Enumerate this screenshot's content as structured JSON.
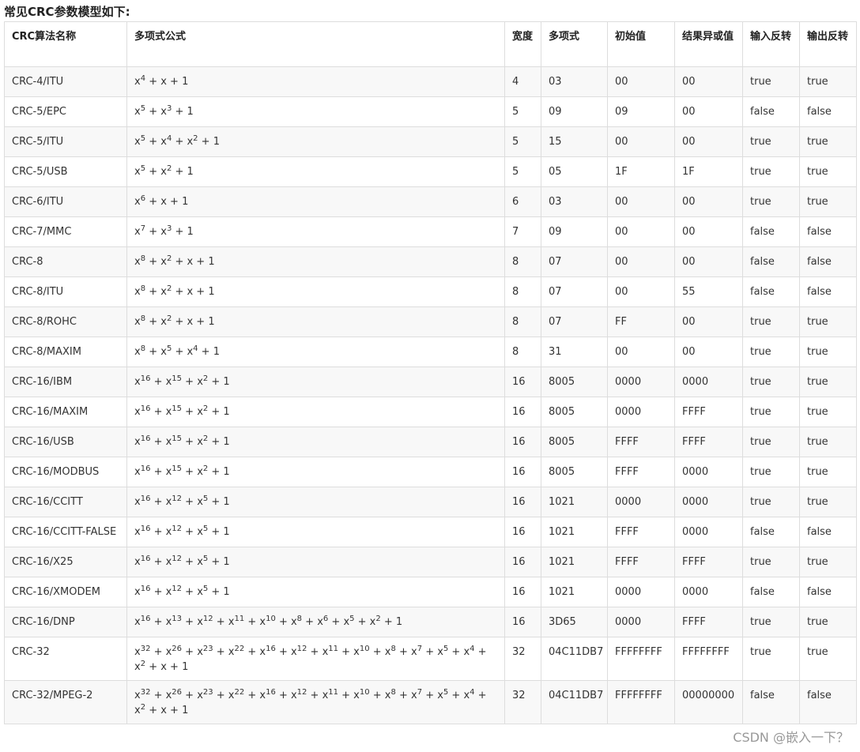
{
  "heading": "常见CRC参数模型如下:",
  "columns": [
    "CRC算法名称",
    "多项式公式",
    "宽度",
    "多项式",
    "初始值",
    "结果异或值",
    "输入反转",
    "输出反转"
  ],
  "rows": [
    {
      "name": "CRC-4/ITU",
      "formula": "x^4 + x + 1",
      "width": "4",
      "poly": "03",
      "init": "00",
      "xorout": "00",
      "refin": "true",
      "refout": "true"
    },
    {
      "name": "CRC-5/EPC",
      "formula": "x^5 + x^3 + 1",
      "width": "5",
      "poly": "09",
      "init": "09",
      "xorout": "00",
      "refin": "false",
      "refout": "false"
    },
    {
      "name": "CRC-5/ITU",
      "formula": "x^5 + x^4 + x^2 + 1",
      "width": "5",
      "poly": "15",
      "init": "00",
      "xorout": "00",
      "refin": "true",
      "refout": "true"
    },
    {
      "name": "CRC-5/USB",
      "formula": "x^5 + x^2 + 1",
      "width": "5",
      "poly": "05",
      "init": "1F",
      "xorout": "1F",
      "refin": "true",
      "refout": "true"
    },
    {
      "name": "CRC-6/ITU",
      "formula": "x^6 + x + 1",
      "width": "6",
      "poly": "03",
      "init": "00",
      "xorout": "00",
      "refin": "true",
      "refout": "true"
    },
    {
      "name": "CRC-7/MMC",
      "formula": "x^7 + x^3 + 1",
      "width": "7",
      "poly": "09",
      "init": "00",
      "xorout": "00",
      "refin": "false",
      "refout": "false"
    },
    {
      "name": "CRC-8",
      "formula": "x^8 + x^2 + x + 1",
      "width": "8",
      "poly": "07",
      "init": "00",
      "xorout": "00",
      "refin": "false",
      "refout": "false"
    },
    {
      "name": "CRC-8/ITU",
      "formula": "x^8 + x^2 + x + 1",
      "width": "8",
      "poly": "07",
      "init": "00",
      "xorout": "55",
      "refin": "false",
      "refout": "false"
    },
    {
      "name": "CRC-8/ROHC",
      "formula": "x^8 + x^2 + x + 1",
      "width": "8",
      "poly": "07",
      "init": "FF",
      "xorout": "00",
      "refin": "true",
      "refout": "true"
    },
    {
      "name": "CRC-8/MAXIM",
      "formula": "x^8 + x^5 + x^4 + 1",
      "width": "8",
      "poly": "31",
      "init": "00",
      "xorout": "00",
      "refin": "true",
      "refout": "true"
    },
    {
      "name": "CRC-16/IBM",
      "formula": "x^16 + x^15 + x^2 + 1",
      "width": "16",
      "poly": "8005",
      "init": "0000",
      "xorout": "0000",
      "refin": "true",
      "refout": "true"
    },
    {
      "name": "CRC-16/MAXIM",
      "formula": "x^16 + x^15 + x^2 + 1",
      "width": "16",
      "poly": "8005",
      "init": "0000",
      "xorout": "FFFF",
      "refin": "true",
      "refout": "true"
    },
    {
      "name": "CRC-16/USB",
      "formula": "x^16 + x^15 + x^2 + 1",
      "width": "16",
      "poly": "8005",
      "init": "FFFF",
      "xorout": "FFFF",
      "refin": "true",
      "refout": "true"
    },
    {
      "name": "CRC-16/MODBUS",
      "formula": "x^16 + x^15 + x^2 + 1",
      "width": "16",
      "poly": "8005",
      "init": "FFFF",
      "xorout": "0000",
      "refin": "true",
      "refout": "true"
    },
    {
      "name": "CRC-16/CCITT",
      "formula": "x^16 + x^12 + x^5 + 1",
      "width": "16",
      "poly": "1021",
      "init": "0000",
      "xorout": "0000",
      "refin": "true",
      "refout": "true"
    },
    {
      "name": "CRC-16/CCITT-FALSE",
      "formula": "x^16 + x^12 + x^5 + 1",
      "width": "16",
      "poly": "1021",
      "init": "FFFF",
      "xorout": "0000",
      "refin": "false",
      "refout": "false"
    },
    {
      "name": "CRC-16/X25",
      "formula": "x^16 + x^12 + x^5 + 1",
      "width": "16",
      "poly": "1021",
      "init": "FFFF",
      "xorout": "FFFF",
      "refin": "true",
      "refout": "true"
    },
    {
      "name": "CRC-16/XMODEM",
      "formula": "x^16 + x^12 + x^5 + 1",
      "width": "16",
      "poly": "1021",
      "init": "0000",
      "xorout": "0000",
      "refin": "false",
      "refout": "false"
    },
    {
      "name": "CRC-16/DNP",
      "formula": "x^16 + x^13 + x^12 + x^11 + x^10 + x^8 + x^6 + x^5 + x^2 + 1",
      "width": "16",
      "poly": "3D65",
      "init": "0000",
      "xorout": "FFFF",
      "refin": "true",
      "refout": "true"
    },
    {
      "name": "CRC-32",
      "formula": "x^32 + x^26 + x^23 + x^22 + x^16 + x^12 + x^11 + x^10 + x^8 + x^7 + x^5 + x^4 + x^2 + x + 1",
      "width": "32",
      "poly": "04C11DB7",
      "init": "FFFFFFFF",
      "xorout": "FFFFFFFF",
      "refin": "true",
      "refout": "true"
    },
    {
      "name": "CRC-32/MPEG-2",
      "formula": "x^32 + x^26 + x^23 + x^22 + x^16 + x^12 + x^11 + x^10 + x^8 + x^7 + x^5 + x^4 + x^2 + x + 1",
      "width": "32",
      "poly": "04C11DB7",
      "init": "FFFFFFFF",
      "xorout": "00000000",
      "refin": "false",
      "refout": "false"
    }
  ],
  "watermark": "CSDN @嵌入一下？"
}
